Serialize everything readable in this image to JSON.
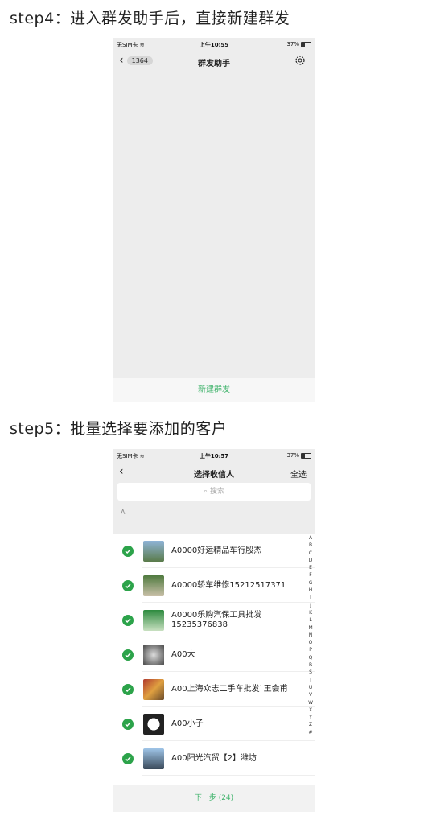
{
  "step4": {
    "title": "step4：进入群发助手后，直接新建群发",
    "status": {
      "carrier": "无SIM卡",
      "time": "上午10:55",
      "battery": "37%"
    },
    "nav": {
      "back_count": "1364",
      "title": "群发助手"
    },
    "bottom_action": "新建群发"
  },
  "step5": {
    "title": "step5：批量选择要添加的客户",
    "status": {
      "carrier": "无SIM卡",
      "time": "上午10:57",
      "battery": "37%"
    },
    "nav": {
      "title": "选择收信人",
      "select_all": "全选"
    },
    "search_placeholder": "搜索",
    "section_letter": "A",
    "contacts": [
      {
        "name": "A0000好运精品车行殷杰"
      },
      {
        "name": "A0000轿车维修15212517371"
      },
      {
        "name": "A0000乐购汽保工具批发15235376838"
      },
      {
        "name": "A00大"
      },
      {
        "name": "A00上海众志二手车批发`王会甫"
      },
      {
        "name": "A00小子"
      },
      {
        "name": "A00阳光汽贸【2】潍坊"
      }
    ],
    "alphabet": [
      "A",
      "B",
      "C",
      "D",
      "E",
      "F",
      "G",
      "H",
      "I",
      "J",
      "K",
      "L",
      "M",
      "N",
      "O",
      "P",
      "Q",
      "R",
      "S",
      "T",
      "U",
      "V",
      "W",
      "X",
      "Y",
      "Z",
      "#"
    ],
    "next_button": "下一步 (24)",
    "colors": {
      "accent": "#2ca34a",
      "action_text": "#3fb36b"
    }
  }
}
